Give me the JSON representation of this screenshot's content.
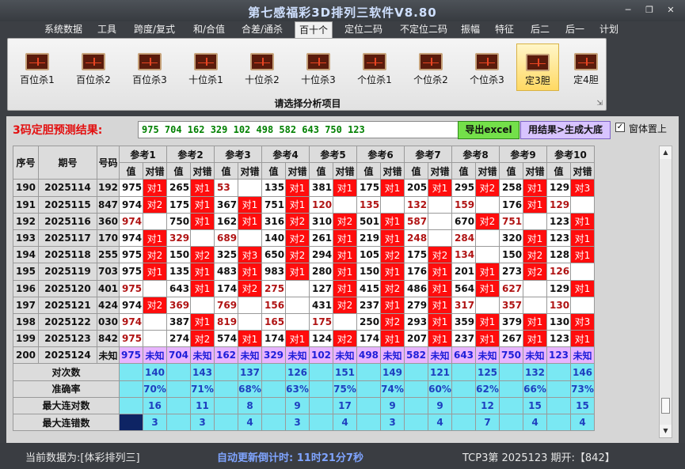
{
  "app": {
    "title": "第七感福彩3D排列三软件V8.80"
  },
  "menu": [
    "系统数据",
    "工具",
    "跨度/复式",
    "和/合值",
    "合差/通杀",
    "百十个",
    "定位二码",
    "不定位二码",
    "振幅",
    "特征",
    "后二",
    "后一",
    "计划"
  ],
  "menu_active": 5,
  "ribbon": {
    "buttons": [
      "百位杀1",
      "百位杀2",
      "百位杀3",
      "十位杀1",
      "十位杀2",
      "十位杀3",
      "个位杀1",
      "个位杀2",
      "个位杀3",
      "定3胆",
      "定4胆"
    ],
    "active": 9,
    "caption": "请选择分析项目"
  },
  "prediction": {
    "label": "3码定胆预测结果:",
    "value": "975  704  162  329  102  498  582  643  750  123",
    "export_label": "导出excel",
    "generate_label": "用结果>生成大底",
    "topmost_label": "窗体置上",
    "topmost_checked": true
  },
  "table": {
    "col_seq": "序号",
    "col_period": "期号",
    "col_draw": "号码",
    "refs": [
      "参考1",
      "参考2",
      "参考3",
      "参考4",
      "参考5",
      "参考6",
      "参考7",
      "参考8",
      "参考9",
      "参考10"
    ],
    "sub_value": "值",
    "sub_result": "对错",
    "rows": [
      {
        "seq": "190",
        "period": "2025114",
        "draw": "192",
        "cells": [
          [
            "975",
            "对1"
          ],
          [
            "265",
            "对1"
          ],
          [
            "53",
            ""
          ],
          [
            "135",
            "对1"
          ],
          [
            "381",
            "对1"
          ],
          [
            "175",
            "对1"
          ],
          [
            "205",
            "对1"
          ],
          [
            "295",
            "对2"
          ],
          [
            "258",
            "对1"
          ],
          [
            "129",
            "对3"
          ]
        ]
      },
      {
        "seq": "191",
        "period": "2025115",
        "draw": "847",
        "cells": [
          [
            "974",
            "对2"
          ],
          [
            "175",
            "对1"
          ],
          [
            "367",
            "对1"
          ],
          [
            "751",
            "对1"
          ],
          [
            "120",
            ""
          ],
          [
            "135",
            ""
          ],
          [
            "132",
            ""
          ],
          [
            "159",
            ""
          ],
          [
            "176",
            "对1"
          ],
          [
            "129",
            ""
          ]
        ]
      },
      {
        "seq": "192",
        "period": "2025116",
        "draw": "360",
        "cells": [
          [
            "974",
            ""
          ],
          [
            "750",
            "对1"
          ],
          [
            "162",
            "对1"
          ],
          [
            "316",
            "对2"
          ],
          [
            "310",
            "对2"
          ],
          [
            "501",
            "对1"
          ],
          [
            "587",
            ""
          ],
          [
            "670",
            "对2"
          ],
          [
            "751",
            ""
          ],
          [
            "123",
            "对1"
          ]
        ]
      },
      {
        "seq": "193",
        "period": "2025117",
        "draw": "170",
        "cells": [
          [
            "974",
            "对1"
          ],
          [
            "329",
            ""
          ],
          [
            "689",
            ""
          ],
          [
            "140",
            "对2"
          ],
          [
            "261",
            "对1"
          ],
          [
            "219",
            "对1"
          ],
          [
            "248",
            ""
          ],
          [
            "284",
            ""
          ],
          [
            "320",
            "对1"
          ],
          [
            "123",
            "对1"
          ]
        ]
      },
      {
        "seq": "194",
        "period": "2025118",
        "draw": "255",
        "cells": [
          [
            "975",
            "对2"
          ],
          [
            "150",
            "对2"
          ],
          [
            "325",
            "对3"
          ],
          [
            "650",
            "对2"
          ],
          [
            "294",
            "对1"
          ],
          [
            "105",
            "对2"
          ],
          [
            "175",
            "对2"
          ],
          [
            "134",
            ""
          ],
          [
            "150",
            "对2"
          ],
          [
            "128",
            "对1"
          ]
        ]
      },
      {
        "seq": "195",
        "period": "2025119",
        "draw": "703",
        "cells": [
          [
            "975",
            "对1"
          ],
          [
            "135",
            "对1"
          ],
          [
            "483",
            "对1"
          ],
          [
            "983",
            "对1"
          ],
          [
            "280",
            "对1"
          ],
          [
            "150",
            "对1"
          ],
          [
            "176",
            "对1"
          ],
          [
            "201",
            "对1"
          ],
          [
            "273",
            "对2"
          ],
          [
            "126",
            ""
          ]
        ]
      },
      {
        "seq": "196",
        "period": "2025120",
        "draw": "401",
        "cells": [
          [
            "975",
            ""
          ],
          [
            "643",
            "对1"
          ],
          [
            "174",
            "对2"
          ],
          [
            "275",
            ""
          ],
          [
            "127",
            "对1"
          ],
          [
            "415",
            "对2"
          ],
          [
            "486",
            "对1"
          ],
          [
            "564",
            "对1"
          ],
          [
            "627",
            ""
          ],
          [
            "129",
            "对1"
          ]
        ]
      },
      {
        "seq": "197",
        "period": "2025121",
        "draw": "424",
        "cells": [
          [
            "974",
            "对2"
          ],
          [
            "369",
            ""
          ],
          [
            "769",
            ""
          ],
          [
            "156",
            ""
          ],
          [
            "431",
            "对2"
          ],
          [
            "237",
            "对1"
          ],
          [
            "279",
            "对1"
          ],
          [
            "317",
            ""
          ],
          [
            "357",
            ""
          ],
          [
            "130",
            ""
          ]
        ]
      },
      {
        "seq": "198",
        "period": "2025122",
        "draw": "030",
        "cells": [
          [
            "974",
            ""
          ],
          [
            "387",
            "对1"
          ],
          [
            "819",
            ""
          ],
          [
            "165",
            ""
          ],
          [
            "175",
            ""
          ],
          [
            "250",
            "对2"
          ],
          [
            "293",
            "对1"
          ],
          [
            "359",
            "对1"
          ],
          [
            "379",
            "对1"
          ],
          [
            "130",
            "对3"
          ]
        ]
      },
      {
        "seq": "199",
        "period": "2025123",
        "draw": "842",
        "cells": [
          [
            "975",
            ""
          ],
          [
            "274",
            "对2"
          ],
          [
            "574",
            "对1"
          ],
          [
            "174",
            "对1"
          ],
          [
            "124",
            "对2"
          ],
          [
            "174",
            "对1"
          ],
          [
            "207",
            "对1"
          ],
          [
            "237",
            "对1"
          ],
          [
            "267",
            "对1"
          ],
          [
            "123",
            "对1"
          ]
        ]
      }
    ],
    "pending": {
      "seq": "200",
      "period": "2025124",
      "draw": "未知",
      "values": [
        "975",
        "704",
        "162",
        "329",
        "102",
        "498",
        "582",
        "643",
        "750",
        "123"
      ],
      "result": "未知"
    },
    "stats": [
      {
        "label": "对次数",
        "values": [
          "140",
          "143",
          "137",
          "126",
          "151",
          "149",
          "121",
          "125",
          "132",
          "146"
        ]
      },
      {
        "label": "准确率",
        "values": [
          "70%",
          "71%",
          "68%",
          "63%",
          "75%",
          "74%",
          "60%",
          "62%",
          "66%",
          "73%"
        ]
      },
      {
        "label": "最大连对数",
        "values": [
          "16",
          "11",
          "8",
          "9",
          "17",
          "9",
          "9",
          "12",
          "15",
          "15"
        ]
      },
      {
        "label": "最大连错数",
        "values": [
          "3",
          "3",
          "4",
          "3",
          "4",
          "3",
          "4",
          "7",
          "4",
          "4"
        ]
      }
    ]
  },
  "status": {
    "left": "当前数据为:[体彩排列三]",
    "mid": "自动更新倒计时:  11时21分7秒",
    "right": "TCP3第 2025123 期开:【842】"
  },
  "colors": {
    "hit": "#ff0d0d",
    "stats_bg": "#7ae8f3",
    "pending_bg": "#e8b4ff",
    "accent_green": "#74e04a"
  }
}
